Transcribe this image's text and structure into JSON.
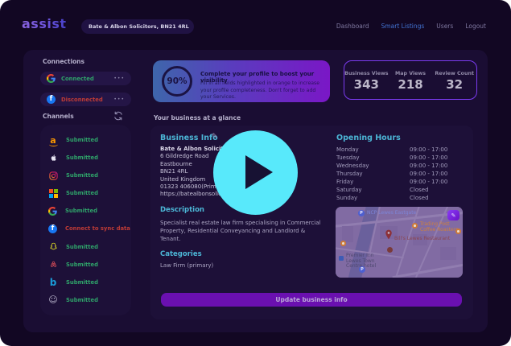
{
  "brand": {
    "logo": "assist"
  },
  "header": {
    "business_selector": "Bate & Albon Solicitors, BN21 4RL",
    "nav": [
      {
        "label": "Dashboard",
        "active": false
      },
      {
        "label": "Smart Listings",
        "active": true
      },
      {
        "label": "Users",
        "active": false
      },
      {
        "label": "Logout",
        "active": false
      }
    ]
  },
  "icons": {
    "more_menu": "•••",
    "edit_pencil": "✎",
    "waze_face": "☺",
    "parking": "P"
  },
  "connections": {
    "title": "Connections",
    "items": [
      {
        "provider": "google",
        "status": "Connected"
      },
      {
        "provider": "facebook",
        "status": "Disconnected"
      }
    ]
  },
  "channels": {
    "title": "Channels",
    "items": [
      {
        "name": "amazon",
        "status": "Submitted",
        "ok": true
      },
      {
        "name": "apple",
        "status": "Submitted",
        "ok": true
      },
      {
        "name": "instagram",
        "status": "Submitted",
        "ok": true
      },
      {
        "name": "microsoft",
        "status": "Submitted",
        "ok": true
      },
      {
        "name": "google",
        "status": "Submitted",
        "ok": true
      },
      {
        "name": "facebook",
        "status": "Connect to sync data",
        "ok": false
      },
      {
        "name": "snapchat",
        "status": "Submitted",
        "ok": true
      },
      {
        "name": "airbnb",
        "status": "Submitted",
        "ok": true
      },
      {
        "name": "bing",
        "status": "Submitted",
        "ok": true
      },
      {
        "name": "waze",
        "status": "Submitted",
        "ok": true
      }
    ]
  },
  "profile_banner": {
    "percent": "90%",
    "title": "Complete your profile to boost your visibility",
    "body": "Fill in all fields highlighted in orange to increase your profile completeness. Don't forget to add your Services."
  },
  "stats": [
    {
      "label": "Business Views",
      "value": "343"
    },
    {
      "label": "Map Views",
      "value": "218"
    },
    {
      "label": "Review Count",
      "value": "32"
    }
  ],
  "glance": {
    "title": "Your business at a glance",
    "business_info": {
      "title": "Business Info",
      "name": "Bate & Albon Solicitors",
      "lines": [
        "6 Gildredge Road",
        "Eastbourne",
        "BN21 4RL",
        "United Kingdom",
        "01323 406080(Primary)",
        "https://batealbonsolicitors"
      ]
    },
    "description": {
      "title": "Description",
      "body": "Specialist real estate law firm specialising in Commercial Property, Residential Conveyancing and Landlord & Tenant."
    },
    "categories": {
      "title": "Categories",
      "value": "Law Firm (primary)"
    },
    "opening_hours": {
      "title": "Opening Hours",
      "rows": [
        [
          "Monday",
          "09:00 - 17:00"
        ],
        [
          "Tuesday",
          "09:00 - 17:00"
        ],
        [
          "Wednesday",
          "09:00 - 17:00"
        ],
        [
          "Thursday",
          "09:00 - 17:00"
        ],
        [
          "Friday",
          "09:00 - 17:00"
        ],
        [
          "Saturday",
          "Closed"
        ],
        [
          "Sunday",
          "Closed"
        ]
      ]
    },
    "map": {
      "labels": [
        "NCP Lewes Eastgate",
        "Trading Post Coffee Roasters",
        "Bill's Lewes Restaurant",
        "Premier Inn Lewes Town Centre hotel"
      ]
    },
    "update_button": "Update business info"
  },
  "colors": {
    "canvas_bg": "#120723",
    "panel_bg": "#1a0d33",
    "card_bg": "#1d1038",
    "teal_heading": "#4cb6d6",
    "status_green": "#2fa36a",
    "status_red": "#bf3b36",
    "nav_active_blue": "#4273d2",
    "stats_border": "#7b3bf0",
    "banner_gradient": [
      "#3e66ab",
      "#7a17c6"
    ],
    "update_button_bg": "#6a10b0",
    "play_button_cyan": "#58e9fb"
  }
}
